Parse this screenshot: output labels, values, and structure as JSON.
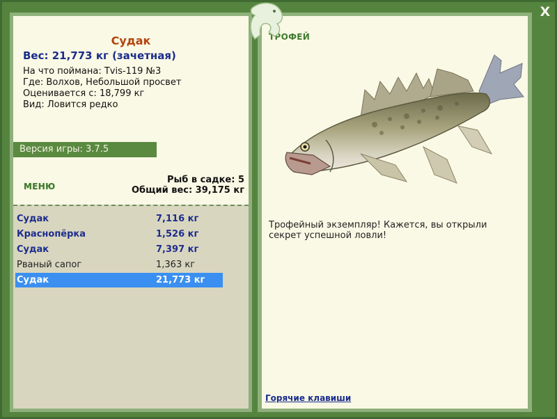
{
  "fish_card": {
    "name": "Судак",
    "weight": "Вес: 21,773 кг (зачетная)",
    "caught_on": "На что поймана: Tvis-119 №3",
    "location": "Где: Волхов, Небольшой просвет",
    "valued_from": "Оценивается с: 18,799 кг",
    "kind": "Вид: Ловится редко"
  },
  "version": "Версия игры: 3.7.5",
  "menu_label": "МЕНЮ",
  "stats": {
    "fish_count": "Рыб в садке: 5",
    "total_weight": "Общий вес: 39,175 кг"
  },
  "catch_list": [
    {
      "name": "Судак",
      "weight": "7,116 кг"
    },
    {
      "name": "Краснопёрка",
      "weight": "1,526 кг"
    },
    {
      "name": "Судак",
      "weight": "7,397 кг"
    },
    {
      "name": "Рваный сапог",
      "weight": "1,363 кг"
    },
    {
      "name": "Судак",
      "weight": "21,773 кг"
    }
  ],
  "trophy": {
    "label": "ТРОФЕЙ",
    "text": "Трофейный экземпляр! Кажется, вы открыли секрет успешной ловли!"
  },
  "hotkeys": "Горячие клавиши",
  "close": "X",
  "colors": {
    "frame": "#55843f",
    "panel": "#faf9e5",
    "list_bg": "#d8d6bf",
    "accent_blue": "#1d2c8d",
    "selected": "#3b8ff0",
    "name_orange": "#b3440f"
  },
  "icons": [
    "dragon-emblem-icon",
    "close-icon",
    "zander-fish-image"
  ]
}
